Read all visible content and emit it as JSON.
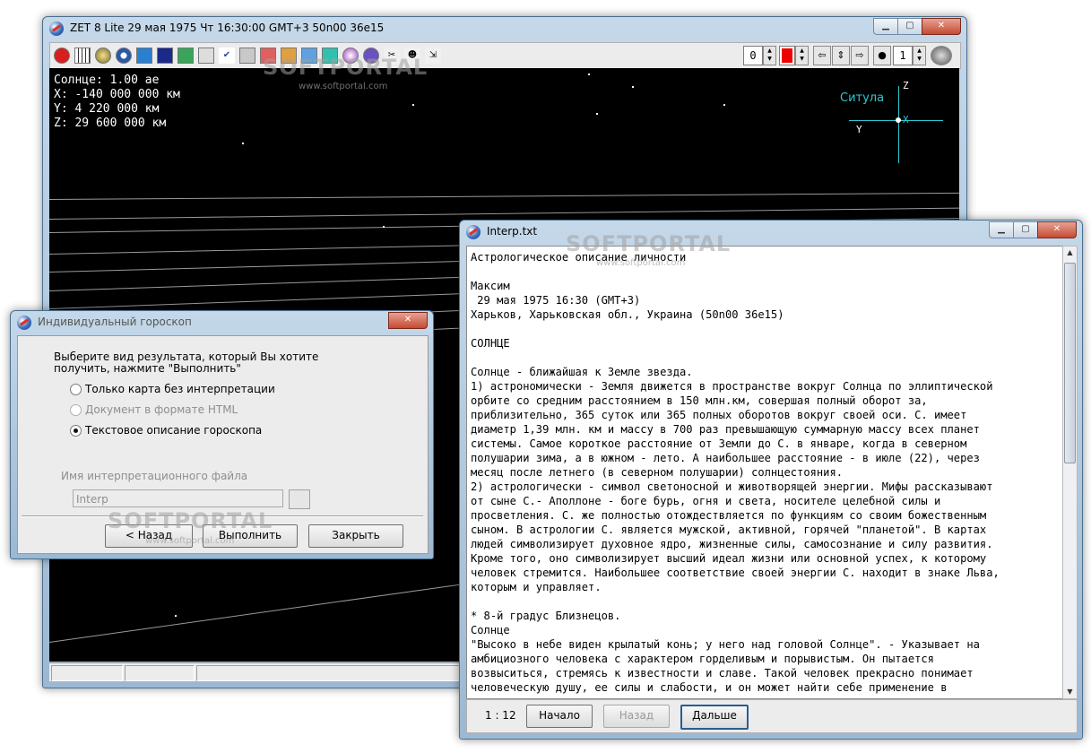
{
  "main_window": {
    "title": "ZET 8 Lite    29 мая 1975  Чт  16:30:00 GMT+3 50n00  36e15",
    "caption_buttons": {
      "minimize": "▁",
      "maximize": "▢",
      "close": "✕"
    },
    "toolbar": {
      "spin_left_value": "0",
      "spin_right_value": "1",
      "color_swatch": "#ee0000"
    },
    "coords": {
      "line1": "Солнце: 1.00 ае",
      "line2": "X: -140 000 000 км",
      "line3": "Y: 4 220 000 км",
      "line4": "Z: 29 600 000 км"
    },
    "axes": {
      "z": "Z",
      "x": "X",
      "y": "Y"
    },
    "star_label": "Ситула",
    "accent_color": "#30c8d0"
  },
  "interp_window": {
    "title": "Interp.txt",
    "text": "Астрологическое описание личности\n\nМаксим\n 29 мая 1975 16:30 (GMT+3)\nХарьков, Харьковская обл., Украина (50n00 36e15)\n\nСОЛНЦЕ\n\nСолнце - ближайшая к Земле звезда.\n1) астрономически - Земля движется в пространстве вокруг Солнца по эллиптической\nорбите со средним расстоянием в 150 млн.км, совершая полный оборот за,\nприблизительно, 365 суток или 365 полных оборотов вокруг своей оси. С. имеет\nдиаметр 1,39 млн. км и массу в 700 раз превышающую суммарную массу всех планет\nсистемы. Самое короткое расстояние от Земли до С. в январе, когда в северном\nполушарии зима, а в южном - лето. А наибольшее расстояние - в июле (22), через\nмесяц после летнего (в северном полушарии) солнцестояния.\n2) астрологически - символ светоносной и животворящей энергии. Мифы рассказывают\nот сыне С.- Аполлоне - боге бурь, огня и света, носителе целебной силы и\nпросветления. С. же полностью отождествляется по функциям со своим божественным\nсыном. В астрологии С. является мужской, активной, горячей \"планетой\". В картах\nлюдей символизирует духовное ядро, жизненные силы, самосознание и силу развития.\nКроме того, оно символизирует высший идеал жизни или основной успех, к которому\nчеловек стремится. Наибольшее соответствие своей энергии С. находит в знаке Льва,\nкоторым и управляет.\n\n* 8-й градус Близнецов.\nСолнце\n\"Высоко в небе виден крылатый конь; у него над головой Солнце\". - Указывает на\nамбициозного человека с характером горделивым и порывистым. Он пытается\nвозвыситься, стремясь к известности и славе. Такой человек прекрасно понимает\nчеловеческую душу, ее силы и слабости, и он может найти себе применение в",
    "position": "1 : 12",
    "buttons": {
      "start": "Начало",
      "back": "Назад",
      "next": "Дальше"
    }
  },
  "dialog": {
    "title": "Индивидуальный гороскоп",
    "prompt": "Выберите вид результата, который Вы хотите получить, нажмите \"Выполнить\"",
    "options": [
      {
        "label": "Только карта без интерпретации",
        "selected": false,
        "enabled": true
      },
      {
        "label": "Документ в формате HTML",
        "selected": false,
        "enabled": false
      },
      {
        "label": "Текстовое описание гороскопа",
        "selected": true,
        "enabled": true
      }
    ],
    "file_label": "Имя интерпретационного файла",
    "file_value": "Interp",
    "buttons": {
      "back": "< Назад",
      "run": "Выполнить",
      "close": "Закрыть"
    }
  },
  "watermark": {
    "brand": "SOFTPORTAL",
    "url": "www.softportal.com"
  }
}
